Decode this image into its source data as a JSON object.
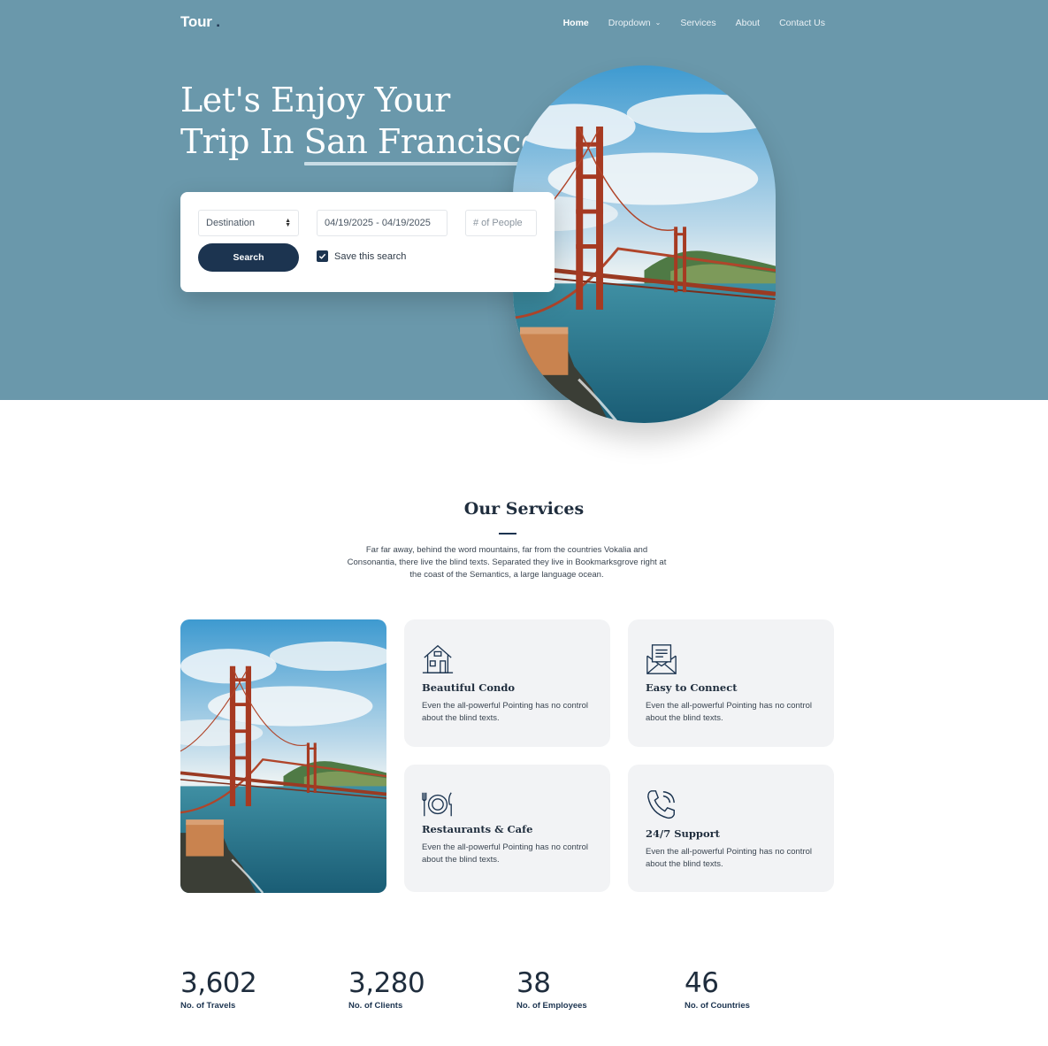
{
  "brand": {
    "name": "Tour",
    "dot": "."
  },
  "nav": {
    "items": [
      {
        "label": "Home"
      },
      {
        "label": "Dropdown"
      },
      {
        "label": "Services"
      },
      {
        "label": "About"
      },
      {
        "label": "Contact Us"
      }
    ]
  },
  "hero": {
    "line1": "Let's Enjoy Your",
    "line2_prefix": "Trip In ",
    "line2_highlight": "San Francisco.",
    "bg_color": "#6a98ab"
  },
  "search": {
    "destination": "Destination",
    "date_range": "04/19/2025 - 04/19/2025",
    "people_placeholder": "# of People",
    "search_button": "Search",
    "save_label": "Save this search",
    "save_checked": true
  },
  "services": {
    "title": "Our Services",
    "description": "Far far away, behind the word mountains, far from the countries Vokalia and Consonantia, there live the blind texts. Separated they live in Bookmarksgrove right at the coast of the Semantics, a large language ocean.",
    "cards": [
      {
        "icon": "house-icon",
        "title": "Beautiful Condo",
        "text": "Even the all-powerful Pointing has no control about the blind texts."
      },
      {
        "icon": "envelope-icon",
        "title": "Easy to Connect",
        "text": "Even the all-powerful Pointing has no control about the blind texts."
      },
      {
        "icon": "plate-icon",
        "title": "Restaurants & Cafe",
        "text": "Even the all-powerful Pointing has no control about the blind texts."
      },
      {
        "icon": "phone-icon",
        "title": "24/7 Support",
        "text": "Even the all-powerful Pointing has no control about the blind texts."
      }
    ]
  },
  "stats": [
    {
      "value": "3,602",
      "label": "No. of Travels"
    },
    {
      "value": "3,280",
      "label": "No. of Clients"
    },
    {
      "value": "38",
      "label": "No. of Employees"
    },
    {
      "value": "46",
      "label": "No. of Countries"
    }
  ],
  "colors": {
    "accent": "#1c3450",
    "card_bg": "#f2f3f5"
  }
}
